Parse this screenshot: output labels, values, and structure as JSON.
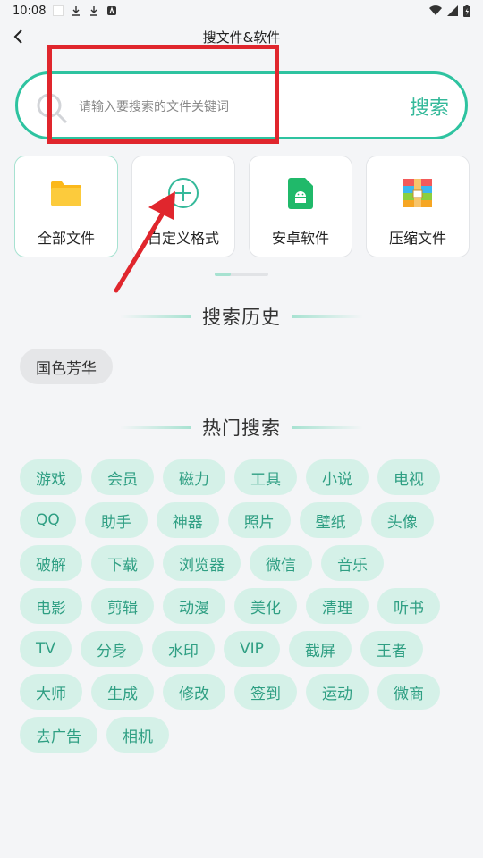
{
  "status": {
    "time": "10:08"
  },
  "header": {
    "title": "搜文件&软件"
  },
  "search": {
    "placeholder": "请输入要搜索的文件关键词",
    "button": "搜索"
  },
  "categories": [
    {
      "label": "全部文件",
      "icon": "folder-icon"
    },
    {
      "label": "自定义格式",
      "icon": "plus-circle-icon"
    },
    {
      "label": "安卓软件",
      "icon": "android-icon"
    },
    {
      "label": "压缩文件",
      "icon": "archive-icon"
    }
  ],
  "history": {
    "title": "搜索历史",
    "items": [
      "国色芳华"
    ]
  },
  "hot": {
    "title": "热门搜索",
    "rows": [
      [
        "游戏",
        "会员",
        "磁力",
        "工具",
        "小说",
        "电视"
      ],
      [
        "QQ",
        "助手",
        "神器",
        "照片",
        "壁纸",
        "头像"
      ],
      [
        "破解",
        "下载",
        "浏览器",
        "微信",
        "音乐"
      ],
      [
        "电影",
        "剪辑",
        "动漫",
        "美化",
        "清理",
        "听书"
      ],
      [
        "TV",
        "分身",
        "水印",
        "VIP",
        "截屏",
        "王者"
      ],
      [
        "大师",
        "生成",
        "修改",
        "签到",
        "运动",
        "微商"
      ],
      [
        "去广告",
        "相机"
      ]
    ]
  },
  "colors": {
    "accent": "#2ec3a0",
    "chip_bg": "#d5f1e8",
    "chip_text": "#2f9f83",
    "annotation": "#e0262d"
  }
}
